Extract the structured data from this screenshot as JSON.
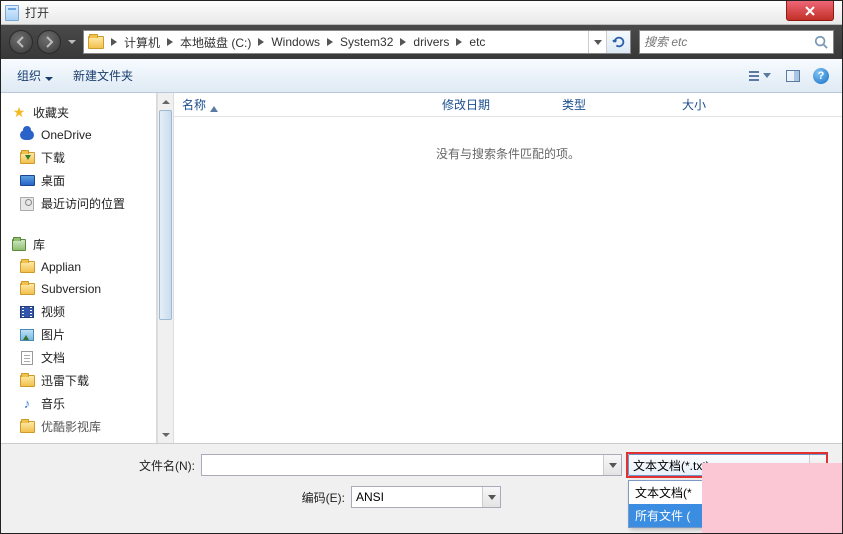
{
  "title": "打开",
  "breadcrumbs": [
    "计算机",
    "本地磁盘 (C:)",
    "Windows",
    "System32",
    "drivers",
    "etc"
  ],
  "search_placeholder": "搜索 etc",
  "toolbar": {
    "organize": "组织",
    "new_folder": "新建文件夹"
  },
  "columns": {
    "name": "名称",
    "date": "修改日期",
    "type": "类型",
    "size": "大小"
  },
  "empty_message": "没有与搜索条件匹配的项。",
  "sidebar": {
    "favorites": {
      "label": "收藏夹",
      "items": [
        "OneDrive",
        "下载",
        "桌面",
        "最近访问的位置"
      ]
    },
    "libraries": {
      "label": "库",
      "items": [
        "Applian",
        "Subversion",
        "视频",
        "图片",
        "文档",
        "迅雷下载",
        "音乐",
        "优酷影视库"
      ]
    }
  },
  "bottom": {
    "filename_label": "文件名(N):",
    "encoding_label": "编码(E):",
    "encoding_value": "ANSI",
    "filetype_value": "文本文档(*.txt)",
    "dropdown_options": [
      "文本文档(*",
      "所有文件 ("
    ]
  }
}
